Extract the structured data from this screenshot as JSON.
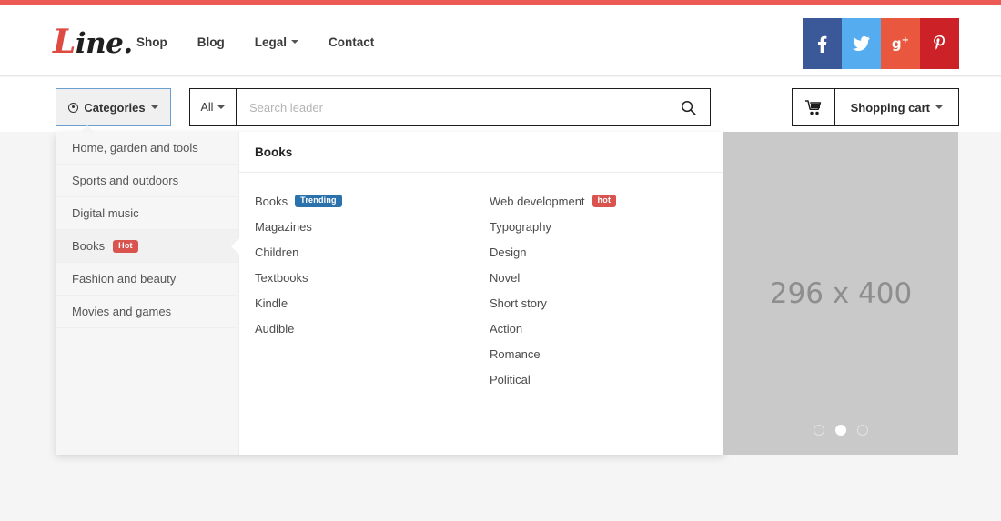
{
  "topbar": {
    "color": "#ec5a55"
  },
  "header": {
    "logo": {
      "accent": "L",
      "rest": "ine."
    },
    "nav": [
      {
        "label": "Shop",
        "has_caret": false
      },
      {
        "label": "Blog",
        "has_caret": false
      },
      {
        "label": "Legal",
        "has_caret": true
      },
      {
        "label": "Contact",
        "has_caret": false
      }
    ],
    "social": [
      {
        "name": "facebook-icon",
        "glyph": "f",
        "color": "#3b5998"
      },
      {
        "name": "twitter-icon",
        "glyph": "🐦",
        "color": "#55acee"
      },
      {
        "name": "google-plus-icon",
        "glyph": "g+",
        "color": "#e9573f"
      },
      {
        "name": "pinterest-icon",
        "glyph": "р",
        "color": "#cc2127"
      }
    ]
  },
  "searchbar": {
    "categories_label": "Categories",
    "scope_label": "All",
    "search_placeholder": "Search leader",
    "search_value": "",
    "cart_label": "Shopping cart"
  },
  "dropdown": {
    "sidebar": [
      {
        "label": "Home, garden and tools",
        "badge": null,
        "active": false
      },
      {
        "label": "Sports and outdoors",
        "badge": null,
        "active": false
      },
      {
        "label": "Digital music",
        "badge": null,
        "active": false
      },
      {
        "label": "Books",
        "badge": {
          "text": "Hot",
          "style": "hot"
        },
        "active": true
      },
      {
        "label": "Fashion and beauty",
        "badge": null,
        "active": false
      },
      {
        "label": "Movies and games",
        "badge": null,
        "active": false
      }
    ],
    "panel_title": "Books",
    "columns": [
      [
        {
          "label": "Books",
          "badge": {
            "text": "Trending",
            "style": "trending"
          }
        },
        {
          "label": "Magazines",
          "badge": null
        },
        {
          "label": "Children",
          "badge": null
        },
        {
          "label": "Textbooks",
          "badge": null
        },
        {
          "label": "Kindle",
          "badge": null
        },
        {
          "label": "Audible",
          "badge": null
        }
      ],
      [
        {
          "label": "Web development",
          "badge": {
            "text": "hot",
            "style": "hot"
          }
        },
        {
          "label": "Typography",
          "badge": null
        },
        {
          "label": "Design",
          "badge": null
        },
        {
          "label": "Novel",
          "badge": null
        },
        {
          "label": "Short story",
          "badge": null
        },
        {
          "label": "Action",
          "badge": null
        },
        {
          "label": "Romance",
          "badge": null
        },
        {
          "label": "Political",
          "badge": null
        }
      ]
    ]
  },
  "carousel": {
    "placeholder_label": "296 x 400",
    "dots": [
      {
        "active": false
      },
      {
        "active": true
      },
      {
        "active": false
      }
    ]
  }
}
